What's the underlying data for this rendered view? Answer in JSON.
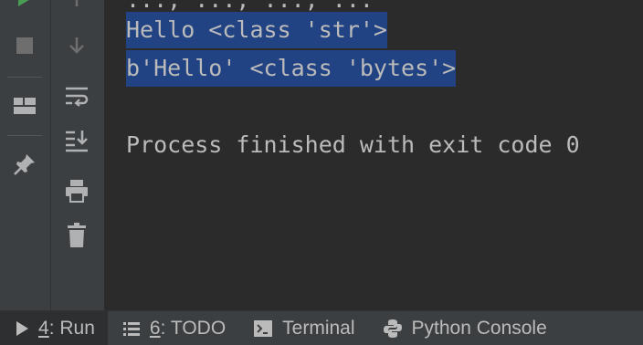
{
  "console": {
    "partial_line": "..., ..., ..., ...",
    "lines": [
      "Hello <class 'str'>",
      "b'Hello' <class 'bytes'>",
      "",
      "Process finished with exit code 0"
    ]
  },
  "tabs": [
    {
      "num": "4",
      "label": ": Run",
      "icon": "play-icon"
    },
    {
      "num": "6",
      "label": ": TODO",
      "icon": "list-icon"
    },
    {
      "num": "",
      "label": "Terminal",
      "icon": "terminal-icon"
    },
    {
      "num": "",
      "label": "Python Console",
      "icon": "python-icon"
    }
  ],
  "colors": {
    "accent_run": "#499c54",
    "selection": "#214283"
  }
}
